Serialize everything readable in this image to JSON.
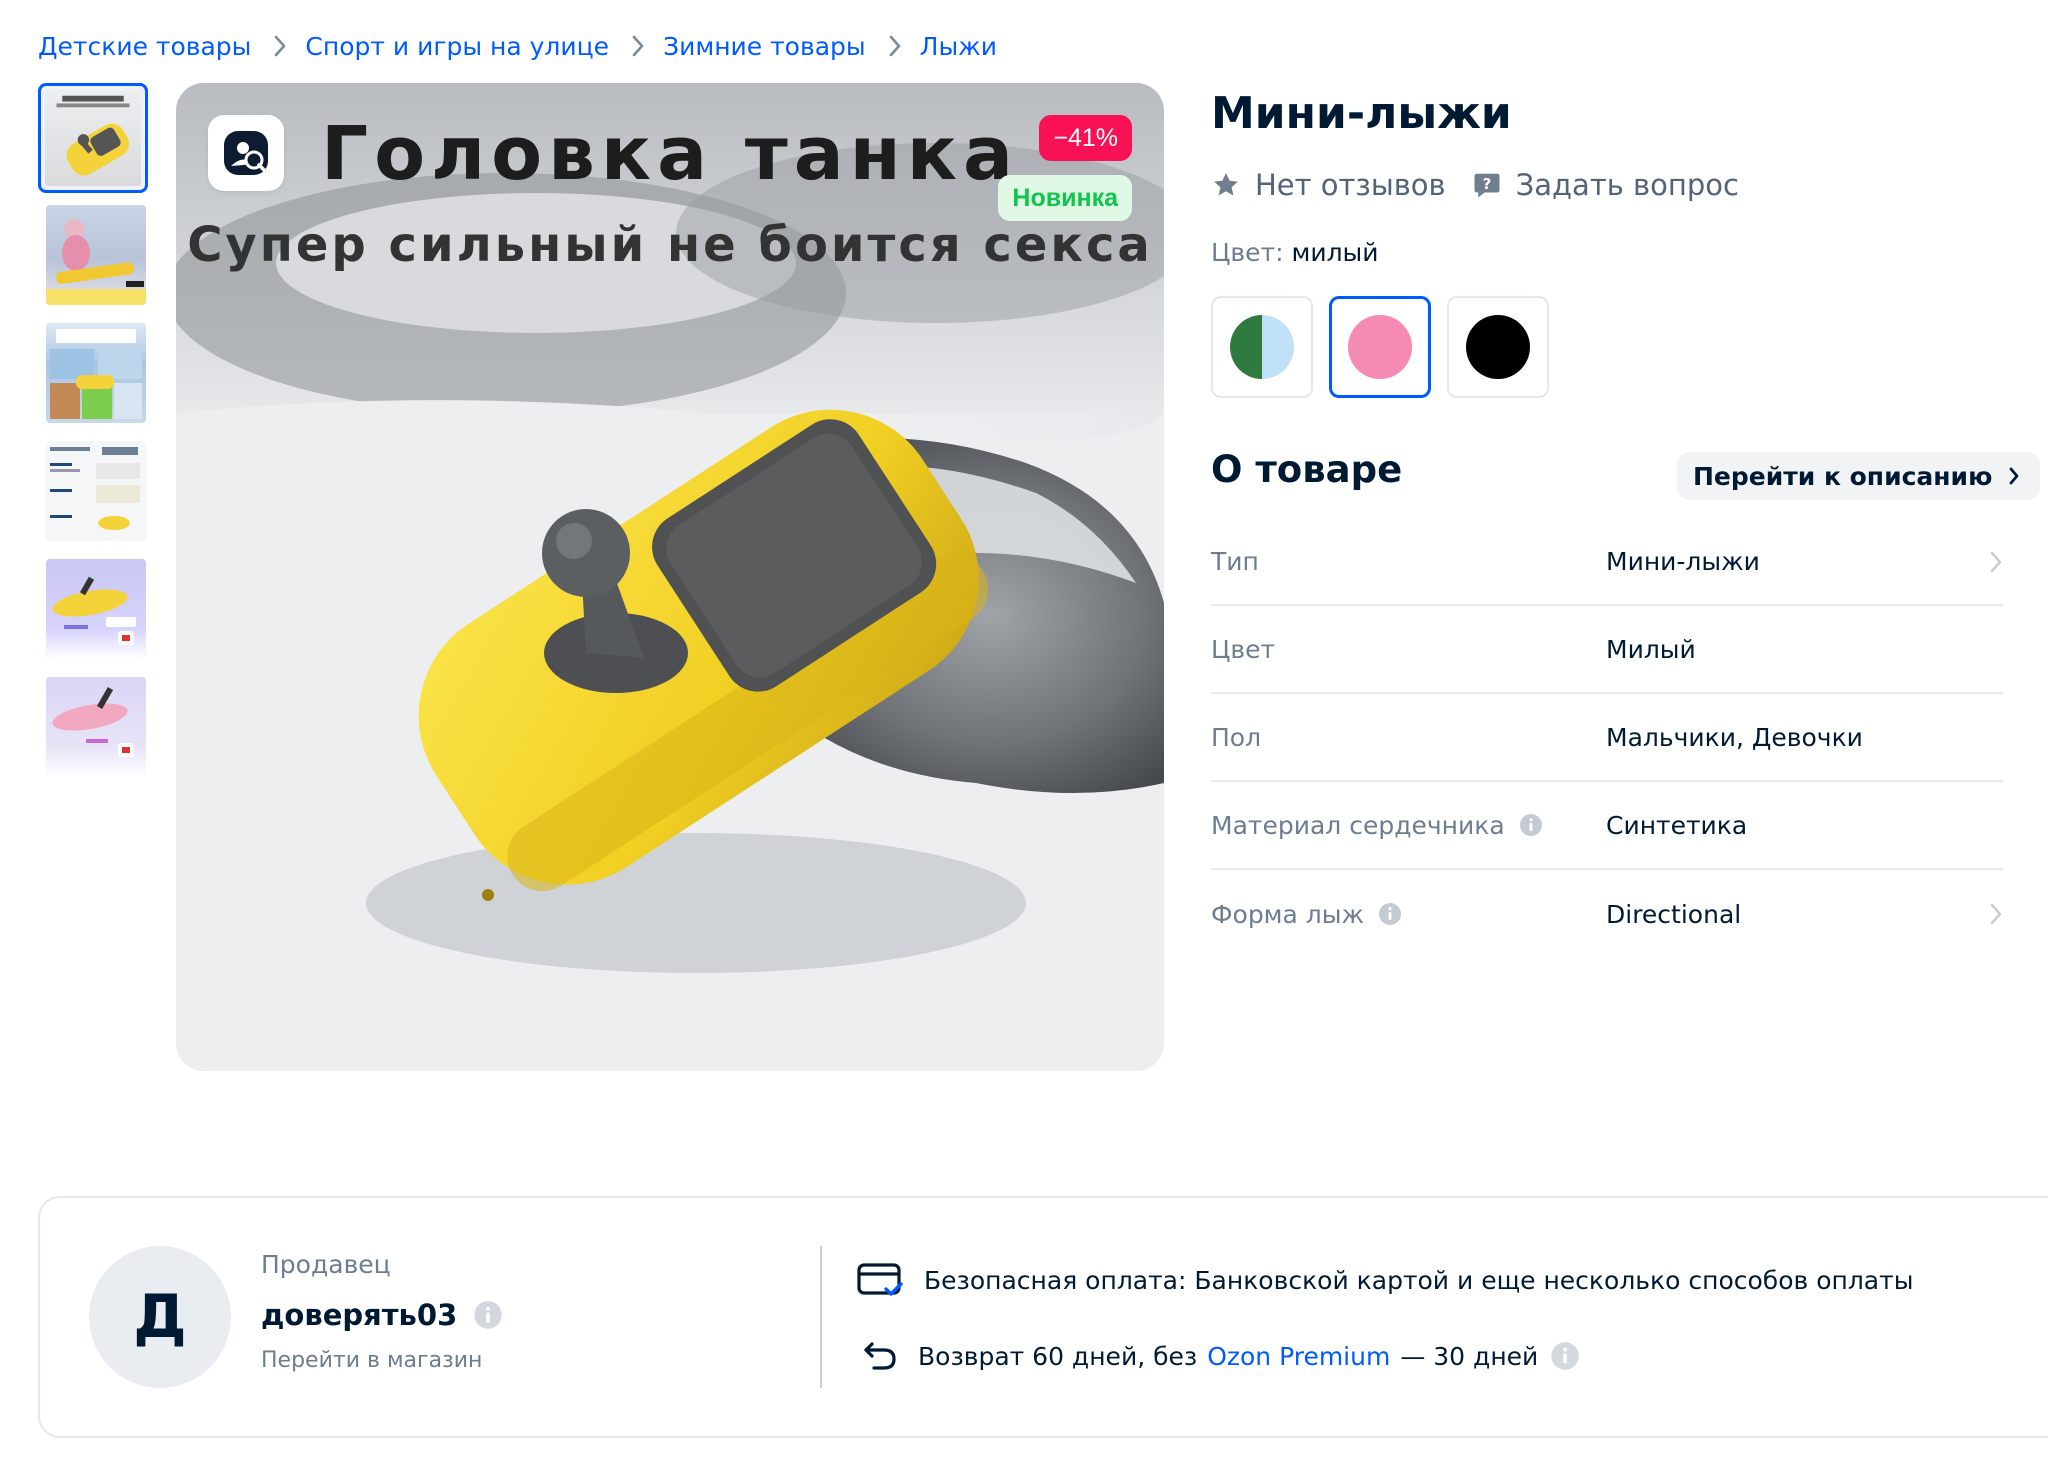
{
  "breadcrumbs": [
    "Детские товары",
    "Спорт и игры на улице",
    "Зимние товары",
    "Лыжи"
  ],
  "main_image": {
    "title": "Головка  танка",
    "subtitle": "Супер  сильный  не  боится  секса",
    "discount_badge": "−41%",
    "new_badge": "Новинка"
  },
  "product": {
    "title": "Мини-лыжи",
    "reviews_label": "Нет отзывов",
    "ask_label": "Задать вопрос",
    "color_label": "Цвет:",
    "color_value": "милый",
    "swatches": [
      {
        "name": "green-blue",
        "selected": false
      },
      {
        "name": "pink",
        "color": "#f58bb5",
        "selected": true
      },
      {
        "name": "black",
        "color": "#000000",
        "selected": false
      }
    ]
  },
  "about": {
    "heading": "О товаре",
    "description_link": "Перейти к описанию",
    "properties": [
      {
        "name": "Тип",
        "value": "Мини-лыжи",
        "info": false,
        "arrow": true
      },
      {
        "name": "Цвет",
        "value": "Милый",
        "info": false,
        "arrow": false
      },
      {
        "name": "Пол",
        "value": "Мальчики, Девочки",
        "info": false,
        "arrow": false
      },
      {
        "name": "Материал сердечника",
        "value": "Синтетика",
        "info": true,
        "arrow": false
      },
      {
        "name": "Форма лыж",
        "value": "Directional",
        "info": true,
        "arrow": true
      }
    ]
  },
  "seller": {
    "avatar_letter": "Д",
    "label": "Продавец",
    "name": "доверять03",
    "store_link": "Перейти в магазин",
    "payment_text": "Безопасная оплата: Банковской картой и еще несколько способов оплаты",
    "return_text_before": "Возврат 60 дней, без",
    "return_link": "Ozon Premium",
    "return_text_after": "— 30 дней"
  },
  "colors": {
    "accent": "#005bff",
    "discount": "#f91155",
    "new_badge_text": "#10c44c",
    "product_yellow": "#f7dc2d"
  }
}
